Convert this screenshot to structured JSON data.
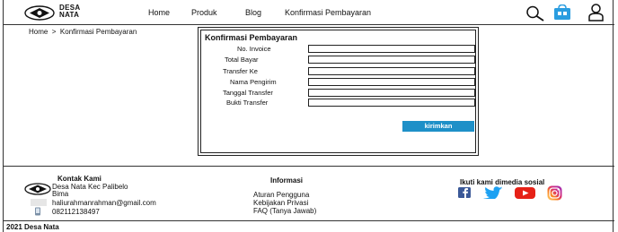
{
  "header": {
    "brand_line1": "DESA",
    "brand_line2": "NATA",
    "nav": [
      "Home",
      "Produk",
      "Blog",
      "Konfirmasi Pembayaran"
    ]
  },
  "breadcrumb": {
    "home": "Home",
    "separator": ">",
    "current": "Konfirmasi Pembayaran"
  },
  "form": {
    "title": "Konfirmasi Pembayaran",
    "fields": [
      {
        "label": "No. Invoice",
        "value": ""
      },
      {
        "label": "Total Bayar",
        "value": ""
      },
      {
        "label": "Transfer Ke",
        "value": ""
      },
      {
        "label": "Nama Pengirim",
        "value": ""
      },
      {
        "label": "Tanggal Transfer",
        "value": ""
      },
      {
        "label": "Bukti Transfer",
        "value": ""
      }
    ],
    "submit_label": "kirimkan"
  },
  "footer": {
    "contact_heading": "Kontak Kami",
    "address_line1": "Desa Nata Kec Palibelo",
    "address_line2": "Bima",
    "email": "haliurahmanrahman@gmail.com",
    "phone": "082112138497",
    "info_heading": "Informasi",
    "info_links": [
      "Aturan Pengguna",
      "Kebijakan Privasi",
      "FAQ (Tanya Jawab)"
    ],
    "social_heading": "Ikuti kami dimedia sosial",
    "copyright": "2021 Desa Nata"
  },
  "colors": {
    "accent": "#1e90c8",
    "facebook": "#3b5998",
    "twitter": "#1da1f2",
    "youtube": "#e62117",
    "instagram": "#d62976"
  }
}
